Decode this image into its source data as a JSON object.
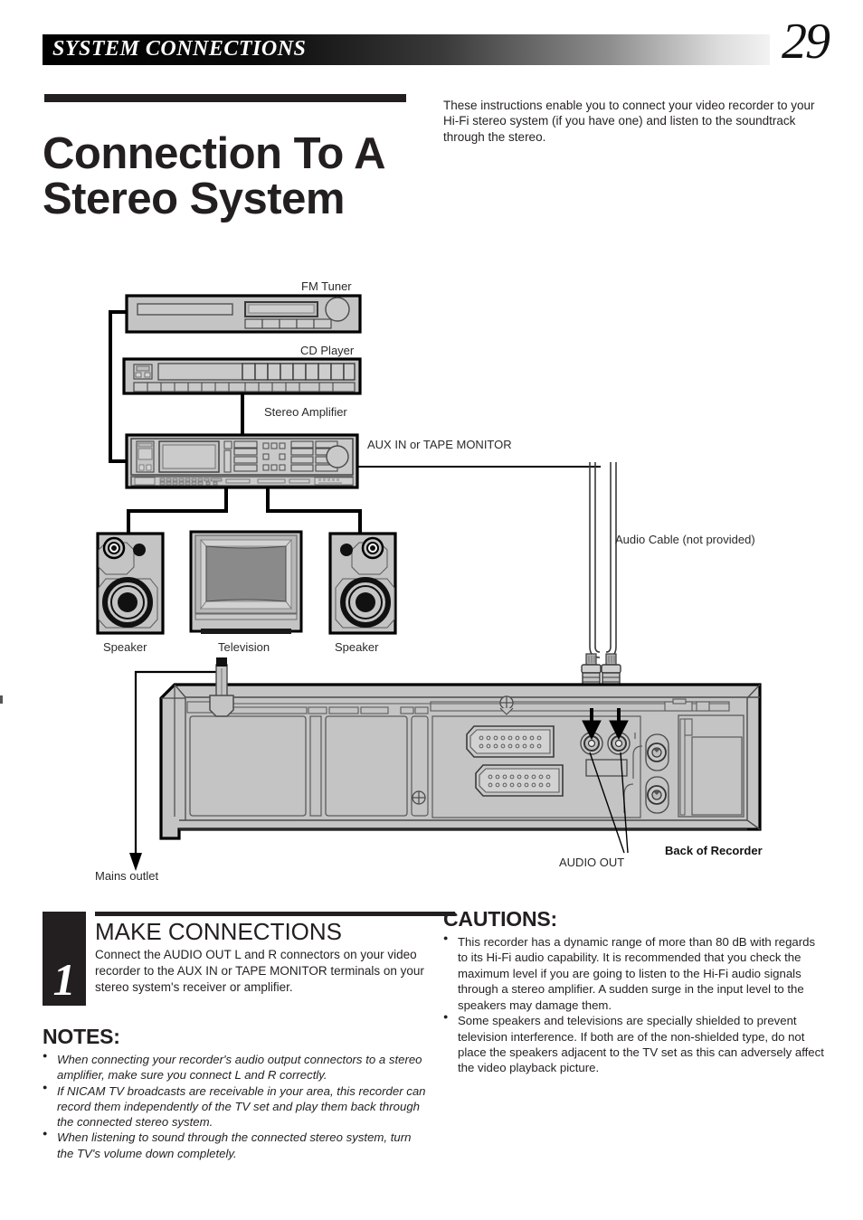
{
  "header": {
    "section_title": "SYSTEM CONNECTIONS",
    "page_number": "29"
  },
  "title": "Connection To A Stereo System",
  "intro": "These instructions enable you to connect your video recorder to your Hi-Fi stereo system (if you have one) and listen to the soundtrack through the stereo.",
  "diagram": {
    "labels": {
      "fm_tuner": "FM Tuner",
      "cd_player": "CD Player",
      "stereo_amplifier": "Stereo Amplifier",
      "aux_in": "AUX IN or TAPE MONITOR",
      "audio_cable": "Audio Cable (not provided)",
      "speaker_left": "Speaker",
      "television": "Television",
      "speaker_right": "Speaker",
      "mains_outlet": "Mains outlet",
      "audio_out": "AUDIO OUT",
      "back_of_recorder": "Back of Recorder"
    }
  },
  "step": {
    "number": "1",
    "heading": "MAKE CONNECTIONS",
    "body": "Connect the AUDIO OUT L and R connectors on your video recorder to the AUX IN or TAPE MONITOR terminals on your stereo system's receiver or amplifier."
  },
  "notes": {
    "heading": "NOTES:",
    "items": [
      "When connecting your recorder's audio output connectors to a stereo amplifier, make sure you connect L and R correctly.",
      "If NICAM TV broadcasts are receivable in your area, this recorder can record them independently of the TV set and play them back through the connected stereo system.",
      "When listening to sound through the connected stereo system, turn the TV's volume down completely."
    ]
  },
  "cautions": {
    "heading": "CAUTIONS:",
    "items": [
      "This recorder has a dynamic range of more than 80 dB with regards to its Hi-Fi audio capability. It is recommended that you check the maximum level if you are going to listen to the Hi-Fi audio signals through a stereo amplifier. A sudden surge in the input level to the speakers may damage them.",
      "Some speakers and televisions are specially shielded to prevent television interference. If both are of the non-shielded type, do not place the speakers adjacent to the TV set as this can adversely affect the video playback picture."
    ]
  },
  "colors": {
    "ink": "#231f20",
    "panel_fill": "#c4c4c4",
    "screen_fill": "#878787",
    "light_fill": "#d8d8d8"
  }
}
